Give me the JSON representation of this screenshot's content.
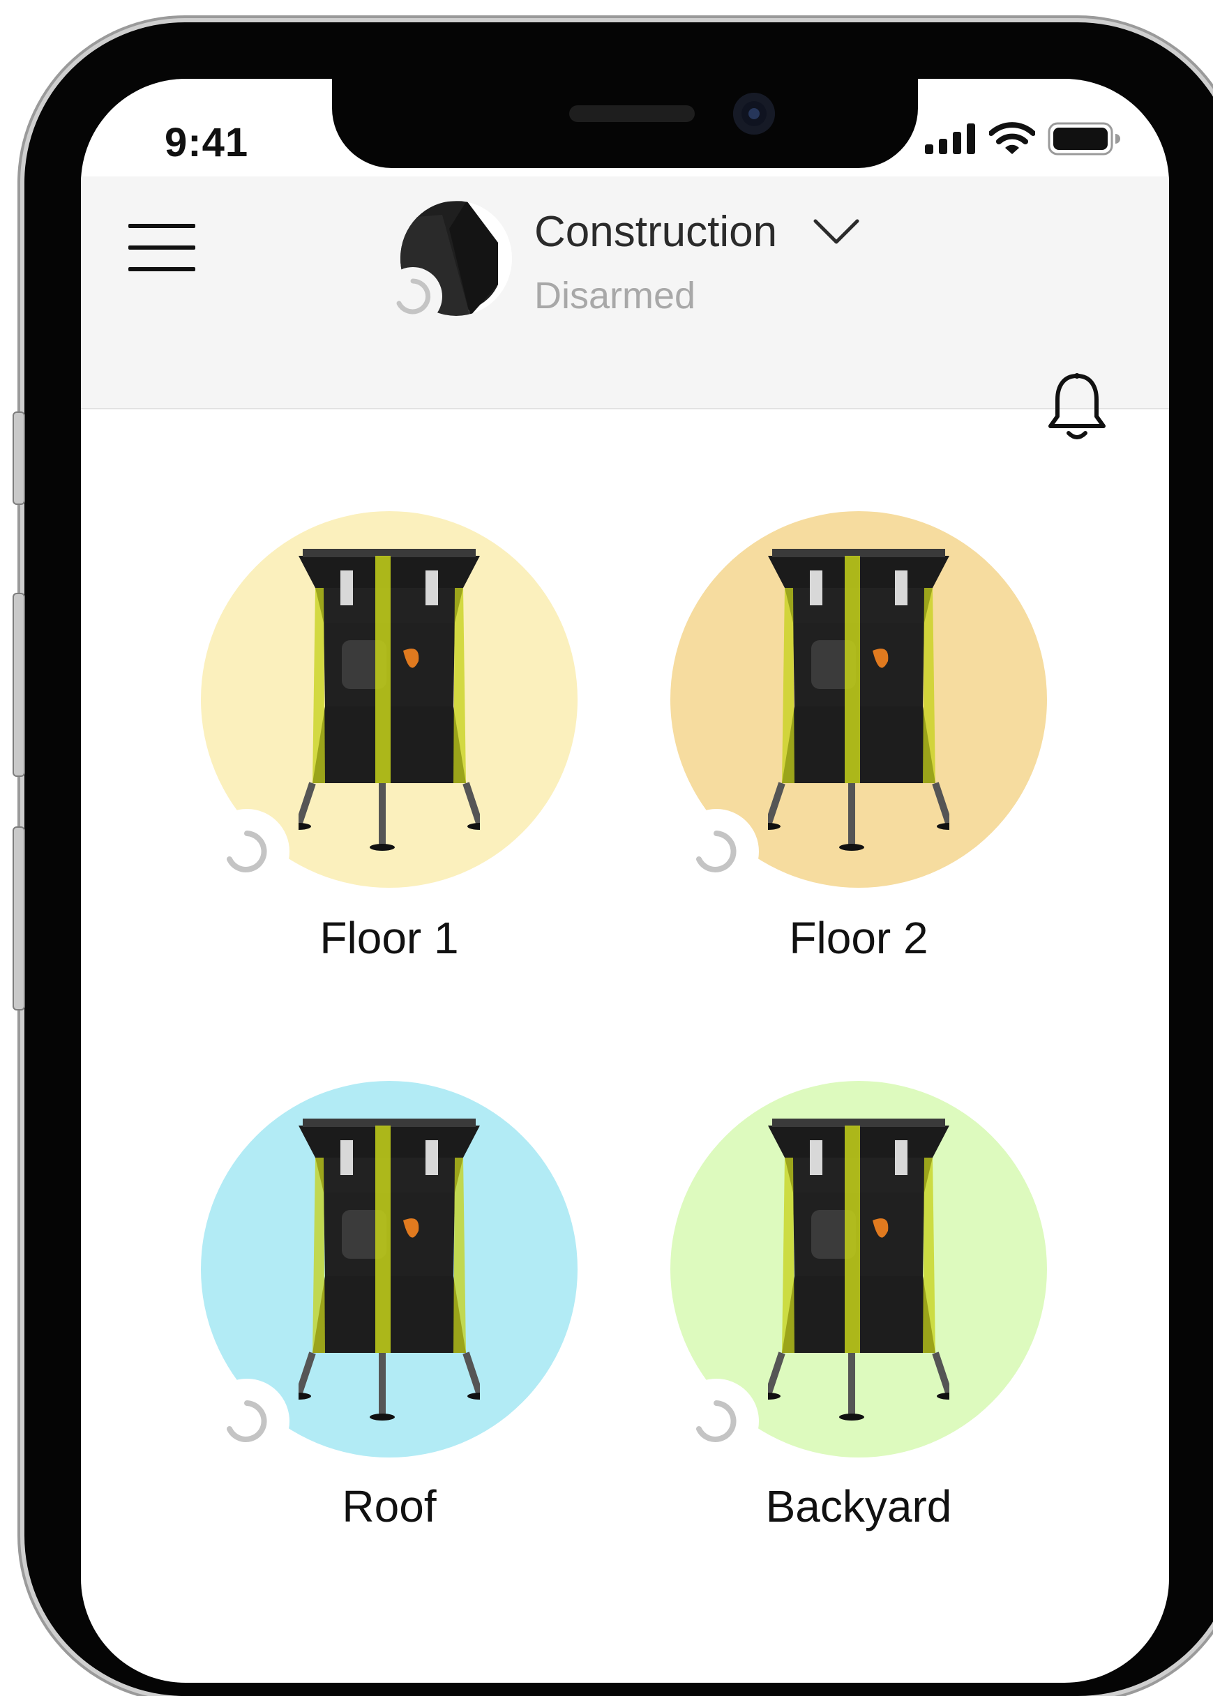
{
  "status_bar": {
    "time": "9:41"
  },
  "header": {
    "site_name": "Construction",
    "site_status": "Disarmed"
  },
  "groups": [
    {
      "label": "Floor 1",
      "color": "#fbf0bd"
    },
    {
      "label": "Floor 2",
      "color": "#f6dc9f"
    },
    {
      "label": "Roof",
      "color": "#b2ebf5"
    },
    {
      "label": "Backyard",
      "color": "#ddfabe"
    }
  ],
  "icons": {
    "menu": "hamburger-icon",
    "notifications": "bell-icon",
    "site_switch": "chevron-down-icon",
    "loading": "spinner-icon"
  },
  "colors": {
    "header_bg": "#f5f5f5",
    "status_text": "#a8a8a8",
    "spinner": "#c4c4c4"
  }
}
